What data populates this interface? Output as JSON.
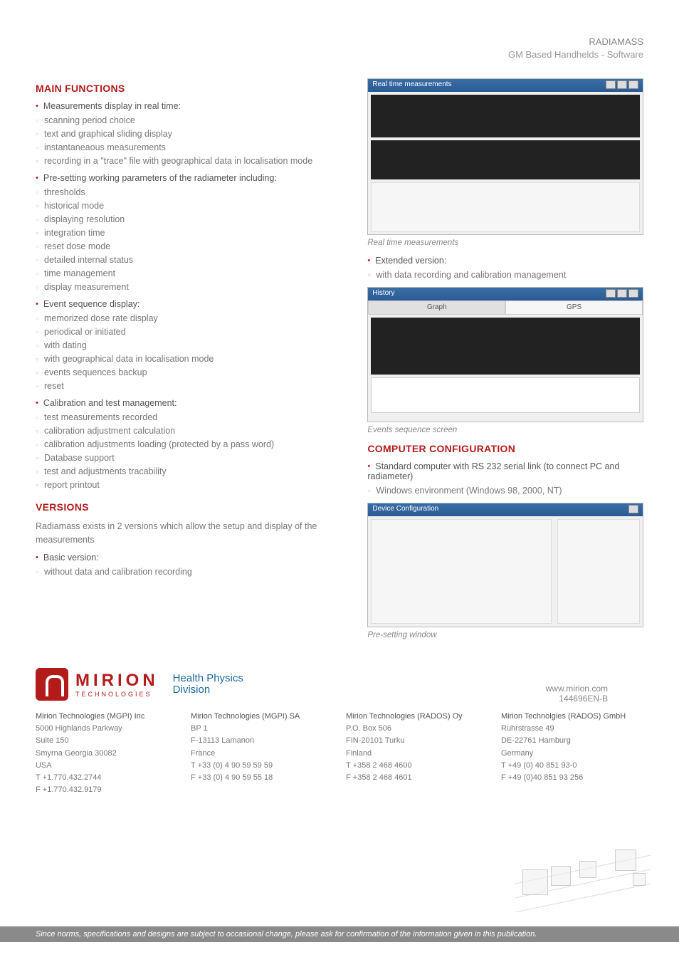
{
  "header": {
    "product": "RADIAMASS",
    "subtitle": "GM Based Handhelds - Software"
  },
  "left": {
    "title_main": "MAIN FUNCTIONS",
    "b1": "Measurements display in real time:",
    "s1a": "scanning period choice",
    "s1b": "text and graphical sliding display",
    "s1c": "instantaneaous measurements",
    "s1d": "recording in a \"trace\" file with geographical data in localisation mode",
    "b2": "Pre-setting working parameters of the radiameter including:",
    "s2a": "thresholds",
    "s2b": "historical mode",
    "s2c": "displaying resolution",
    "s2d": "integration time",
    "s2e": "reset dose mode",
    "s2f": "detailed internal status",
    "s2g": "time management",
    "s2h": "display measurement",
    "b3": "Event sequence display:",
    "s3a": "memorized dose rate display",
    "s3b": "periodical or initiated",
    "s3c": "with dating",
    "s3d": "with geographical data in localisation mode",
    "s3e": "events sequences backup",
    "s3f": "reset",
    "b4": "Calibration and test management:",
    "s4a": "test measurements recorded",
    "s4b": "calibration adjustment calculation",
    "s4c": "calibration adjustments loading (protected by a pass word)",
    "s4d": "Database support",
    "s4e": "test and adjustments tracability",
    "s4f": "report printout",
    "title_versions": "VERSIONS",
    "versions_intro": "Radiamass exists in 2 versions which allow the setup and display of the measurements",
    "v1": "Basic version:",
    "v1a": "without data and calibration recording"
  },
  "right": {
    "shot1_title": "Real time measurements",
    "shot1_caption": "Real time measurements",
    "ext1": "Extended version:",
    "ext1a": "with data recording and calibration management",
    "shot2_title": "History",
    "shot2_caption": "Events sequence screen",
    "title_comp": "COMPUTER CONFIGURATION",
    "c1": "Standard computer with RS 232 serial link (to connect PC and radiameter)",
    "c2": "Windows environment (Windows 98, 2000, NT)",
    "shot3_title": "Device Configuration",
    "shot3_caption": "Pre-setting window"
  },
  "logo": {
    "brand": "MIRION",
    "tag": "TECHNOLOGIES",
    "div_a": "Health Physics",
    "div_b": "Division"
  },
  "site": {
    "url": "www.mirion.com",
    "doc": "144696EN-B"
  },
  "contacts": {
    "c1": {
      "name": "Mirion Technologies (MGPI) Inc",
      "l1": "5000 Highlands Parkway",
      "l2": "Suite 150",
      "l3": "Smyrna Georgia 30082",
      "l4": "USA",
      "t": "T   +1.770.432.2744",
      "f": "F   +1.770.432.9179"
    },
    "c2": {
      "name": "Mirion Technologies (MGPI) SA",
      "l1": "BP 1",
      "l2": "F-13113 Lamanon",
      "l3": "France",
      "l4": "",
      "t": "T   +33 (0) 4 90 59 59 59",
      "f": "F   +33 (0) 4 90 59 55 18"
    },
    "c3": {
      "name": "Mirion Technologies (RADOS) Oy",
      "l1": "P.O. Box 506",
      "l2": "FIN-20101 Turku",
      "l3": "Finland",
      "l4": "",
      "t": "T   +358 2 468 4600",
      "f": "F   +358 2 468 4601"
    },
    "c4": {
      "name": "Mirion Technolgies (RADOS) GmbH",
      "l1": "Ruhrstrasse 49",
      "l2": "DE-22761 Hamburg",
      "l3": "Germany",
      "l4": "",
      "t": "T   +49 (0) 40 851 93-0",
      "f": "F   +49 (0)40 851 93 256"
    }
  },
  "disclaimer": "Since norms, specifications and designs are subject to occasional change, please ask for confirmation of the information given in this publication."
}
